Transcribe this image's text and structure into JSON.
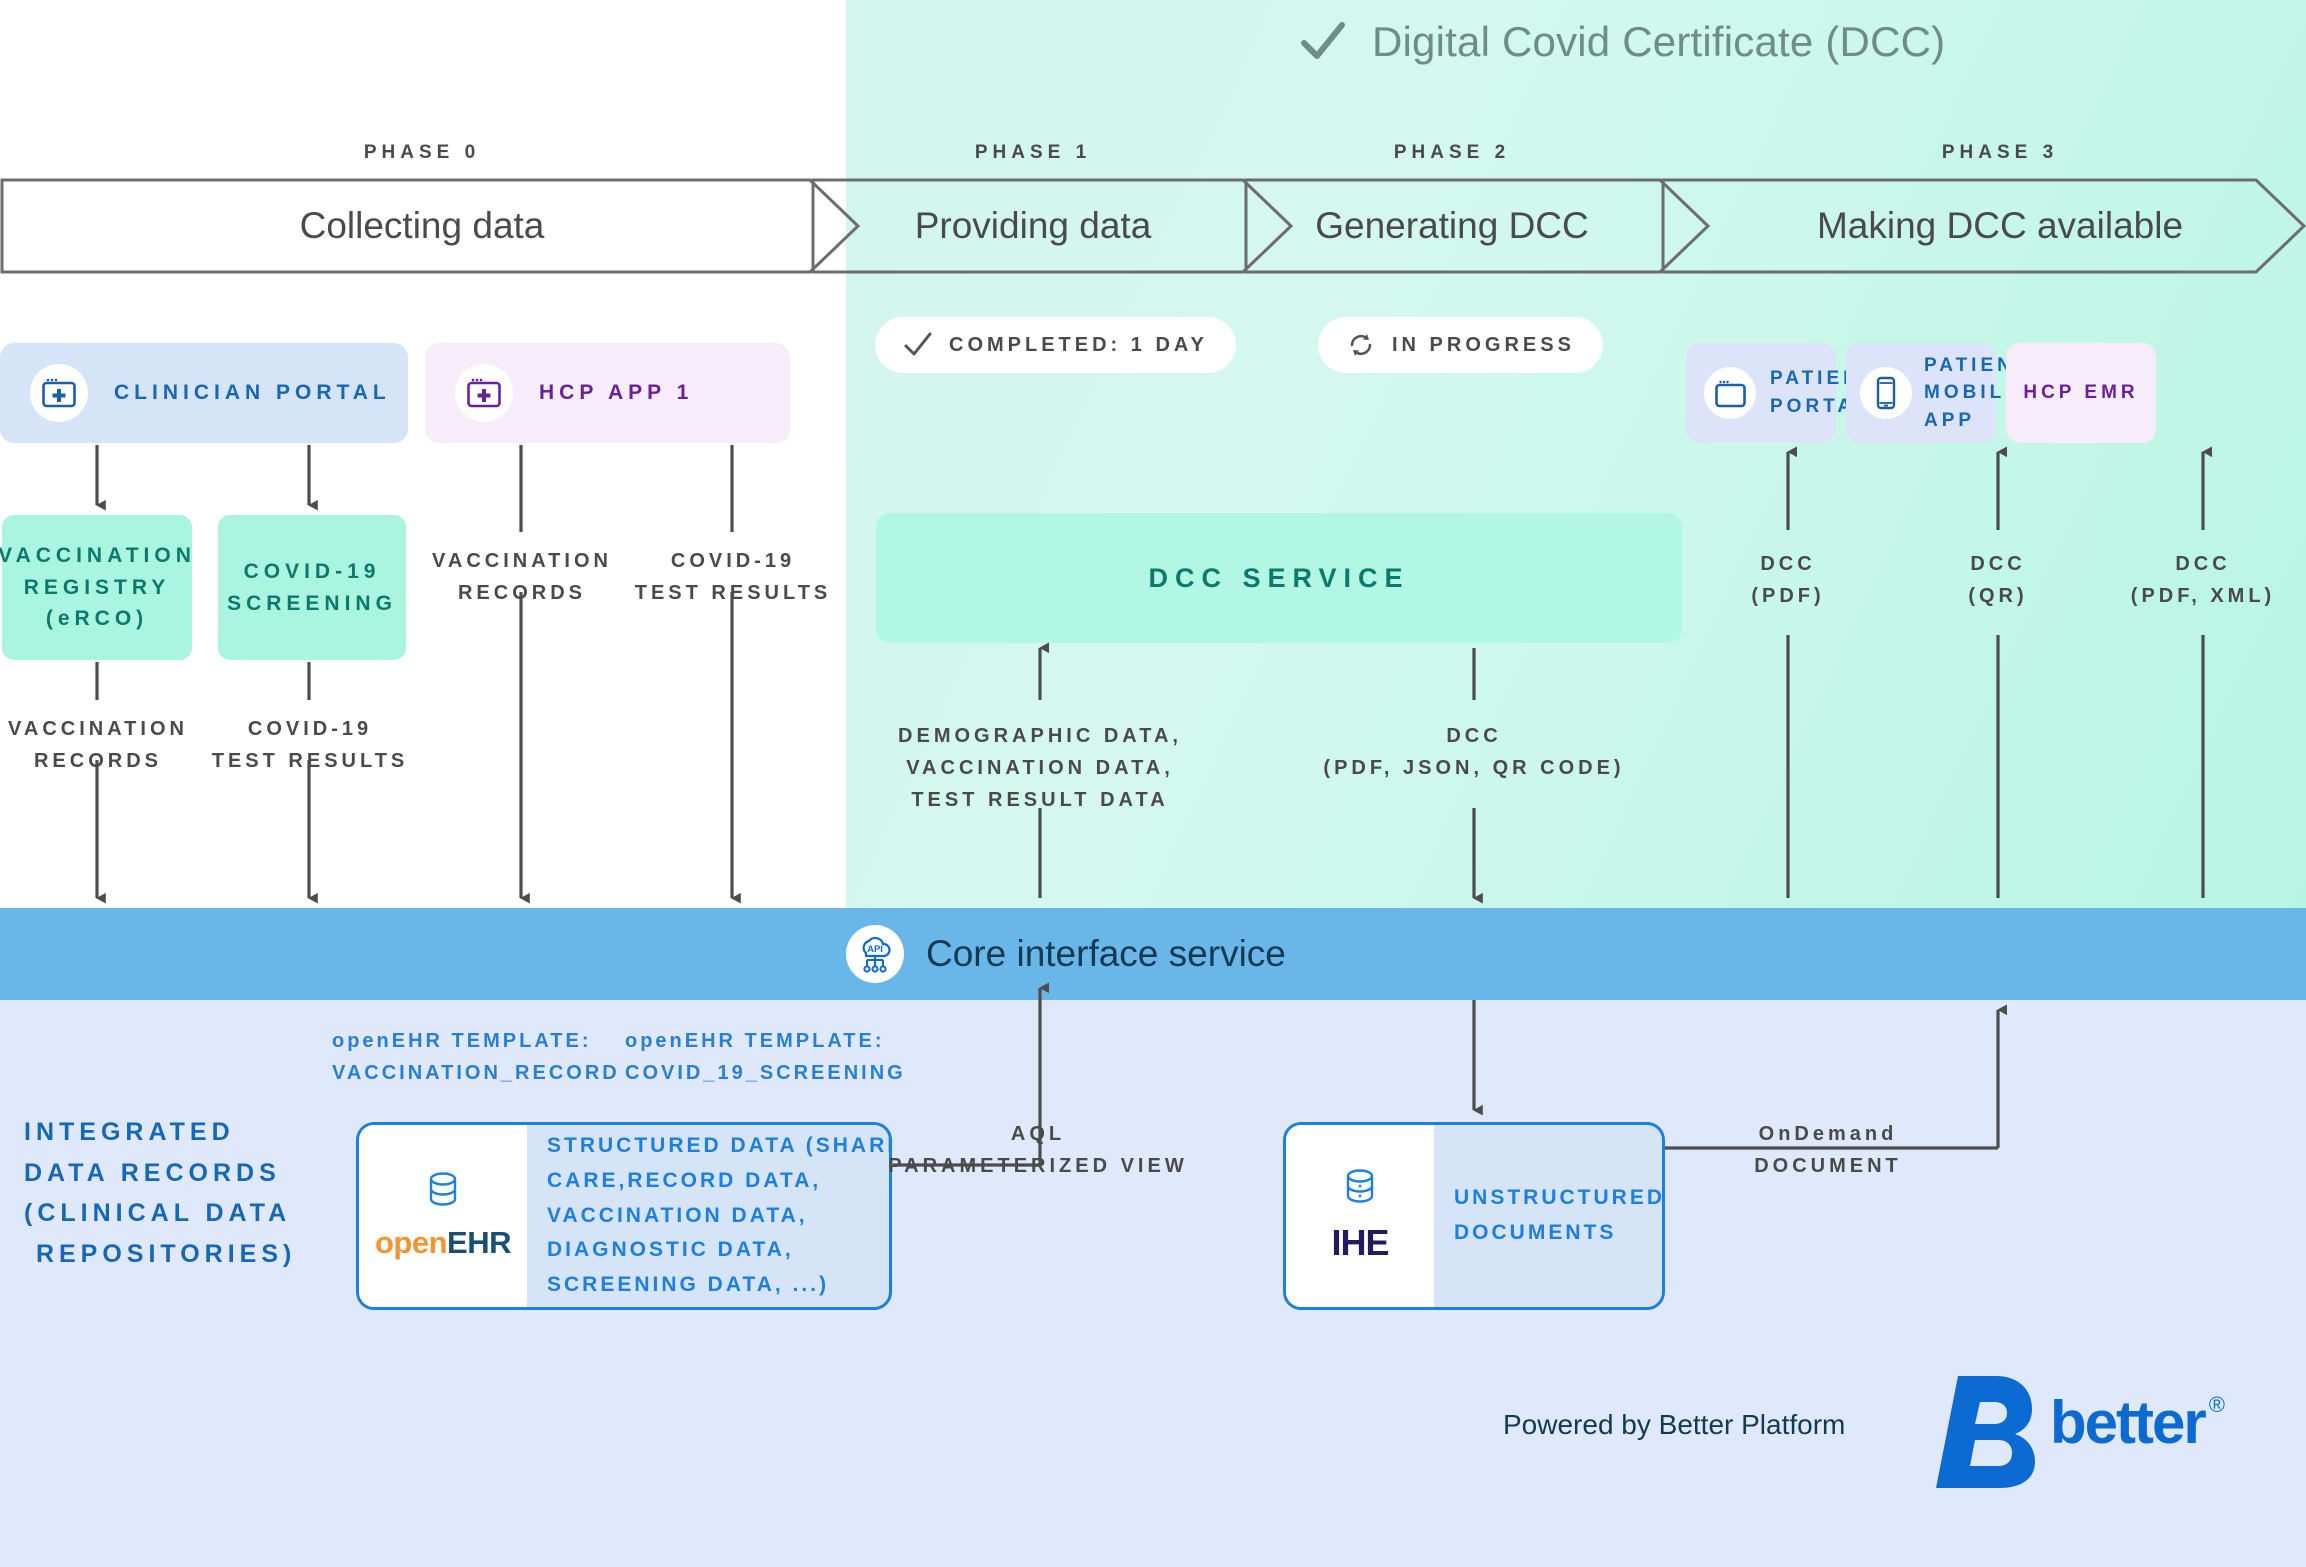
{
  "title": {
    "text": "Digital Covid Certificate (DCC)",
    "check_icon": "check-icon"
  },
  "phases": [
    {
      "tag": "PHASE 0",
      "name": "Collecting data"
    },
    {
      "tag": "PHASE 1",
      "name": "Providing data"
    },
    {
      "tag": "PHASE 2",
      "name": "Generating DCC"
    },
    {
      "tag": "PHASE 3",
      "name": "Making DCC available"
    }
  ],
  "status": [
    {
      "label": "COMPLETED: 1 DAY",
      "icon": "check-icon"
    },
    {
      "label": "IN PROGRESS",
      "icon": "refresh-icon"
    }
  ],
  "source_apps": [
    {
      "label": "CLINICIAN PORTAL",
      "icon": "browser-plus-icon"
    },
    {
      "label": "HCP APP 1",
      "icon": "browser-plus-icon"
    }
  ],
  "registries": [
    {
      "label": "VACCINATION\nREGISTRY\n(eRCO)"
    },
    {
      "label": "COVID-19\nSCREENING"
    }
  ],
  "flow_labels": {
    "hcp_vaccination": "VACCINATION\nRECORDS",
    "hcp_test": "COVID-19\nTEST RESULTS",
    "reg_vaccination": "VACCINATION\nRECORDS",
    "reg_test": "COVID-19\nTEST RESULTS",
    "to_dcc": "DEMOGRAPHIC DATA,\nVACCINATION DATA,\nTEST RESULT DATA",
    "from_dcc": "DCC\n(PDF, JSON, QR CODE)",
    "patient_portal": "DCC\n(PDF)",
    "patient_mobile": "DCC\n(QR)",
    "hcp_emr": "DCC\n(PDF, XML)",
    "aql": "AQL\nPARAMETERIZED VIEW",
    "ondemand": "OnDemand\nDOCUMENT"
  },
  "dcc_service": {
    "label": "DCC SERVICE"
  },
  "output_apps": [
    {
      "label": "PATIENT\nPORTAL",
      "icon": "browser-icon"
    },
    {
      "label": "PATIENT\nMOBILE\nAPP",
      "icon": "mobile-icon"
    },
    {
      "label": "HCP EMR",
      "icon": "none"
    }
  ],
  "core_service": {
    "label": "Core interface service",
    "icon": "api-cloud-icon"
  },
  "idr": {
    "heading": "INTEGRATED\nDATA RECORDS\n(CLINICAL DATA\n REPOSITORIES)"
  },
  "templates": [
    {
      "label": "openEHR TEMPLATE:\nVACCINATION_RECORD"
    },
    {
      "label": "openEHR TEMPLATE:\nCOVID_19_SCREENING"
    }
  ],
  "repositories": [
    {
      "logo_a": "open",
      "logo_b": "EHR",
      "icon": "database-icon",
      "body": "STRUCTURED DATA (SHARED\nCARE,RECORD DATA,\nVACCINATION DATA,\nDIAGNOSTIC DATA,\nSCREENING DATA, ...)"
    },
    {
      "logo": "IHE",
      "icon": "database-icon",
      "body": "UNSTRUCTURED\nDOCUMENTS"
    }
  ],
  "footer": {
    "powered": "Powered by Better Platform",
    "brand": "better",
    "registered": "®"
  },
  "colors": {
    "green_band": "#c9f7ea",
    "core_bar": "#69b7e8",
    "idr_bg": "#dfe9fb",
    "mint": "#a9f5e0",
    "brand_blue": "#0b6bd3",
    "purple": "#6a1f9e",
    "teal_text": "#0b7a6d"
  }
}
